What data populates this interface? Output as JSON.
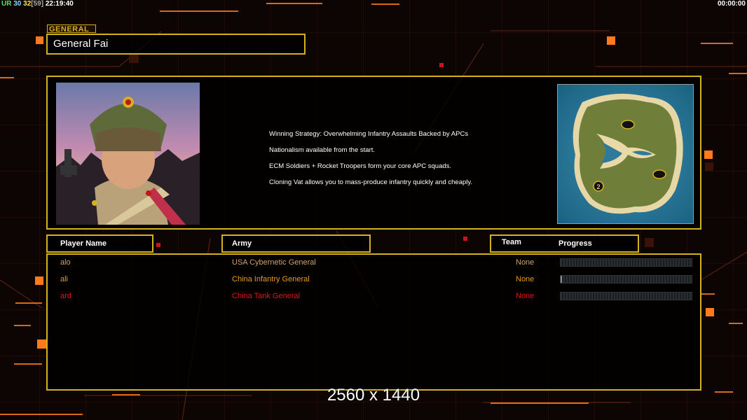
{
  "hud": {
    "left_segments": [
      "UR",
      "30",
      "32",
      "[59]",
      "22:19:40"
    ],
    "right_timer": "00:00:00"
  },
  "header": {
    "section_tag": "GENERAL",
    "general_name": "General Fai"
  },
  "strategy_lines": [
    "Winning Strategy: Overwhelming Infantry Assaults Backed by APCs",
    "Nationalism available from the start.",
    "ECM Soldiers + Rocket Troopers form your core APC squads.",
    "Cloning Vat allows you to mass-produce infantry quickly and cheaply."
  ],
  "minimap": {
    "start_marker": "2",
    "icon": "island-map"
  },
  "table": {
    "headers": {
      "player_name": "Player Name",
      "army": "Army",
      "team": "Team",
      "progress": "Progress"
    },
    "rows": [
      {
        "player": "alo",
        "army": "USA Cybernetic General",
        "team": "None",
        "progress": 0.0,
        "color": "#d0a06a"
      },
      {
        "player": "ali",
        "army": "China Infantry General",
        "team": "None",
        "progress": 0.01,
        "color": "#e79a1c"
      },
      {
        "player": "ard",
        "army": "China Tank General",
        "team": "None",
        "progress": 0.0,
        "color": "#e6150f"
      }
    ]
  },
  "resolution_label": "2560 x 1440",
  "colors": {
    "accent_gold": "#d4b21d",
    "background": "#0c0504",
    "orange_glow": "#ff6a00"
  }
}
